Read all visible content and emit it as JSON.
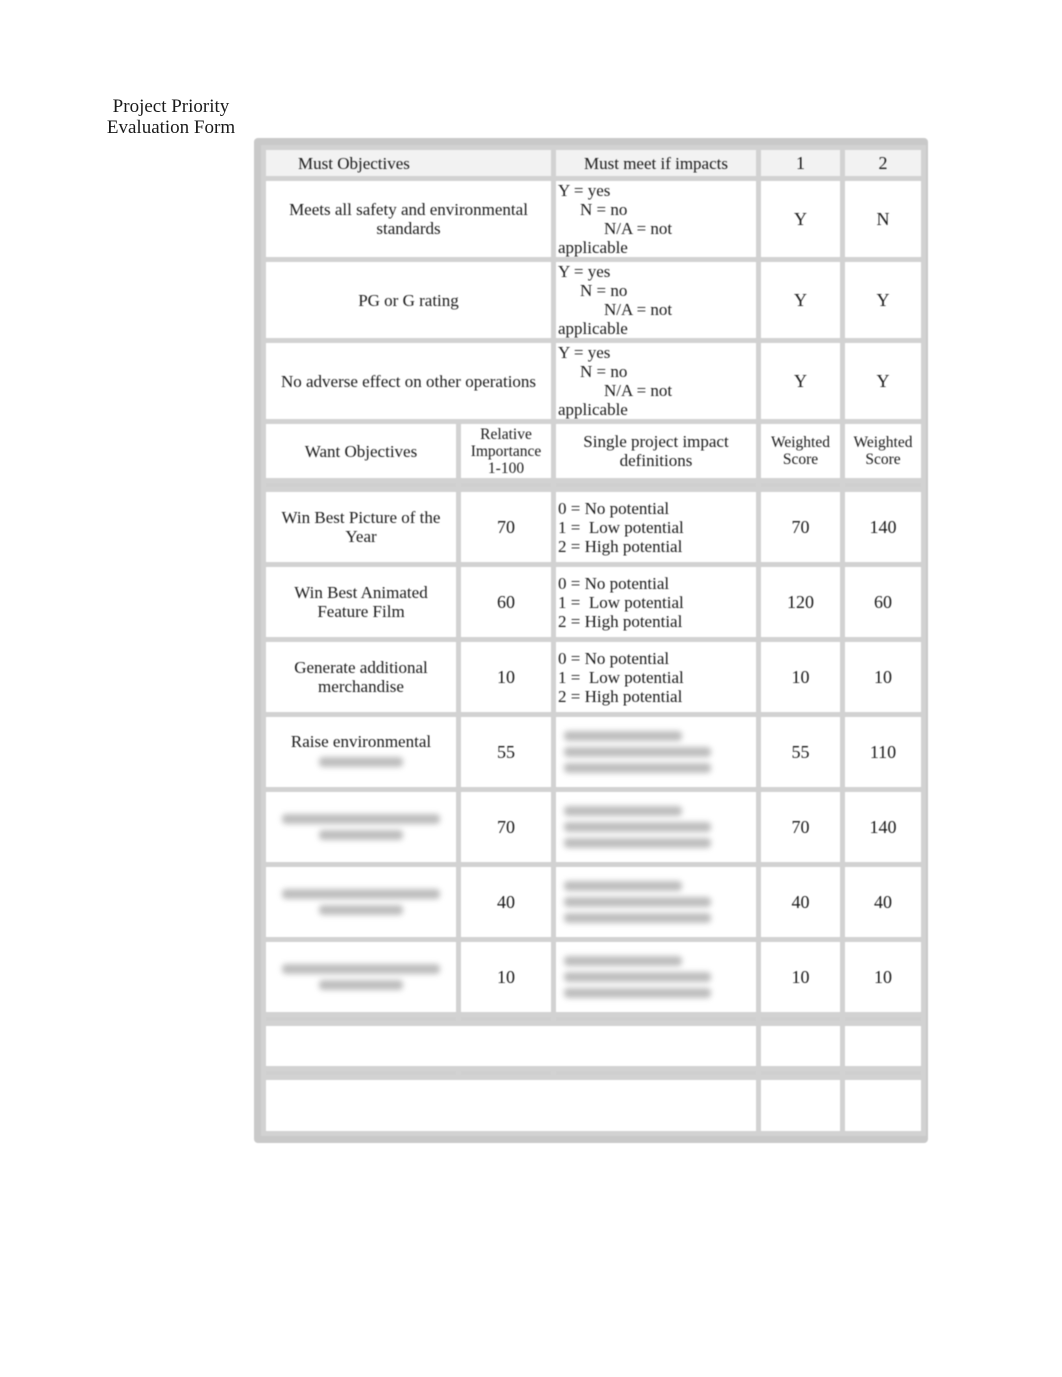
{
  "title": {
    "line1": "Project Priority",
    "line2": "Evaluation Form"
  },
  "must_header": {
    "objectives": "Must Objectives",
    "impacts": "Must meet if impacts",
    "project1": "1",
    "project2": "2"
  },
  "must_legend": {
    "yes": "Y = yes",
    "no": "N = no",
    "na": "N/A = not",
    "na_cont": "applicable"
  },
  "must_rows": [
    {
      "objective": "Meets all safety and environmental standards",
      "p1": "Y",
      "p2": "N"
    },
    {
      "objective": "PG or G rating",
      "p1": "Y",
      "p2": "Y"
    },
    {
      "objective": "No adverse effect on other operations",
      "p1": "Y",
      "p2": "Y"
    }
  ],
  "want_header": {
    "objectives": "Want Objectives",
    "importance": "Relative Importance 1-100",
    "definitions": "Single project impact definitions",
    "score1": "Weighted Score",
    "score2": "Weighted Score"
  },
  "want_legend": {
    "l0": "0 = No potential",
    "l1": "1 =  Low potential",
    "l2": "2 = High potential"
  },
  "want_rows": [
    {
      "objective": "Win Best Picture of the Year",
      "importance": "70",
      "score1": "70",
      "score2": "140",
      "legend_visible": true
    },
    {
      "objective": "Win Best Animated Feature Film",
      "importance": "60",
      "score1": "120",
      "score2": "60",
      "legend_visible": true
    },
    {
      "objective": "Generate additional merchandise",
      "importance": "10",
      "score1": "10",
      "score2": "10",
      "legend_visible": true
    },
    {
      "objective": "Raise environmental",
      "importance": "55",
      "score1": "55",
      "score2": "110",
      "legend_visible": false
    },
    {
      "objective": "",
      "importance": "70",
      "score1": "70",
      "score2": "140",
      "legend_visible": false
    },
    {
      "objective": "",
      "importance": "40",
      "score1": "40",
      "score2": "40",
      "legend_visible": false
    },
    {
      "objective": "",
      "importance": "10",
      "score1": "10",
      "score2": "10",
      "legend_visible": false
    }
  ]
}
